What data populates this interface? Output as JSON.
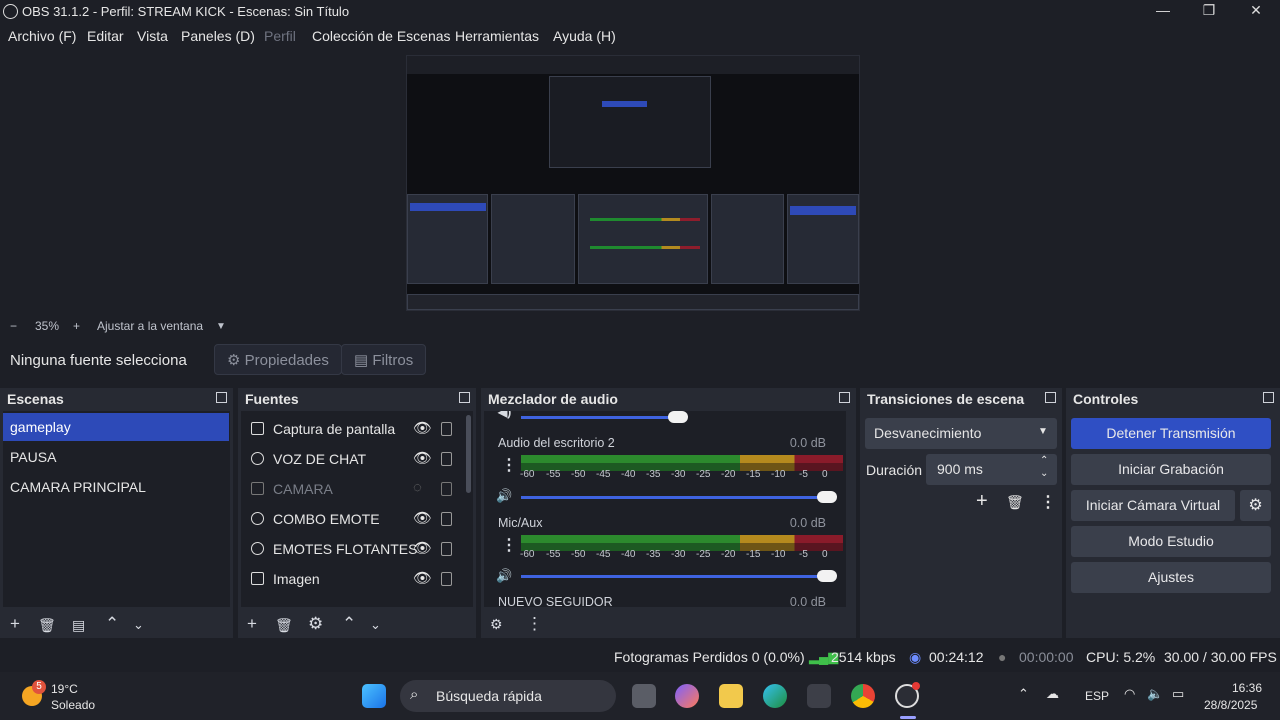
{
  "window": {
    "title": "OBS 31.1.2 - Perfil: STREAM KICK - Escenas: Sin Título",
    "minimize": "—",
    "maximize": "❐",
    "close": "✕"
  },
  "menu": {
    "items": [
      "Archivo (F)",
      "Editar",
      "Vista",
      "Paneles (D)",
      "Perfil",
      "Colección de Escenas",
      "Herramientas",
      "Ayuda (H)"
    ]
  },
  "zoom": {
    "minus": "−",
    "value": "35%",
    "plus": "+",
    "fit_label": "Ajustar a la ventana"
  },
  "context": {
    "no_source": "Ninguna fuente selecciona",
    "properties": "Propiedades",
    "filters": "Filtros"
  },
  "scenes": {
    "title": "Escenas",
    "items": [
      "gameplay",
      "PAUSA",
      "CAMARA PRINCIPAL"
    ],
    "active_index": 0
  },
  "sources": {
    "title": "Fuentes",
    "items": [
      {
        "name": "Captura de pantalla",
        "icon": "monitor-icon",
        "visible": true
      },
      {
        "name": "VOZ DE CHAT",
        "icon": "globe-icon",
        "visible": true
      },
      {
        "name": "CAMARA",
        "icon": "camera-icon",
        "visible": false
      },
      {
        "name": "COMBO EMOTE",
        "icon": "globe-icon",
        "visible": true
      },
      {
        "name": "EMOTES FLOTANTES",
        "icon": "globe-icon",
        "visible": true
      },
      {
        "name": "Imagen",
        "icon": "image-icon",
        "visible": true
      }
    ]
  },
  "mixer": {
    "title": "Mezclador de audio",
    "channels": [
      {
        "name": "Audio del escritorio 2",
        "db": "0.0 dB",
        "volume": 1.0
      },
      {
        "name": "Mic/Aux",
        "db": "0.0 dB",
        "volume": 1.0
      },
      {
        "name": "NUEVO SEGUIDOR",
        "db": "0.0 dB"
      }
    ],
    "ticks": [
      "-60",
      "-55",
      "-50",
      "-45",
      "-40",
      "-35",
      "-30",
      "-25",
      "-20",
      "-15",
      "-10",
      "-5",
      "0"
    ]
  },
  "transitions": {
    "title": "Transiciones de escena",
    "selected": "Desvanecimiento",
    "duration_label": "Duración",
    "duration_value": "900 ms"
  },
  "controls": {
    "title": "Controles",
    "stop_stream": "Detener Transmisión",
    "start_recording": "Iniciar Grabación",
    "start_virtual_cam": "Iniciar Cámara Virtual",
    "studio_mode": "Modo Estudio",
    "settings": "Ajustes"
  },
  "status": {
    "dropped_frames": "Fotogramas Perdidos 0 (0.0%)",
    "bitrate": "2514 kbps",
    "stream_time": "00:24:12",
    "rec_time": "00:00:00",
    "cpu": "CPU: 5.2%",
    "fps": "30.00 / 30.00 FPS"
  },
  "taskbar": {
    "weather_temp": "19°C",
    "weather_desc": "Soleado",
    "weather_badge": "5",
    "search": "Búsqueda rápida",
    "lang": "ESP",
    "time": "16:36",
    "date": "28/8/2025"
  },
  "colors": {
    "accent": "#2d4ab8",
    "meter_green": "#2c8a2d",
    "meter_yellow": "#b58a1e",
    "meter_red": "#8a1b2a"
  }
}
